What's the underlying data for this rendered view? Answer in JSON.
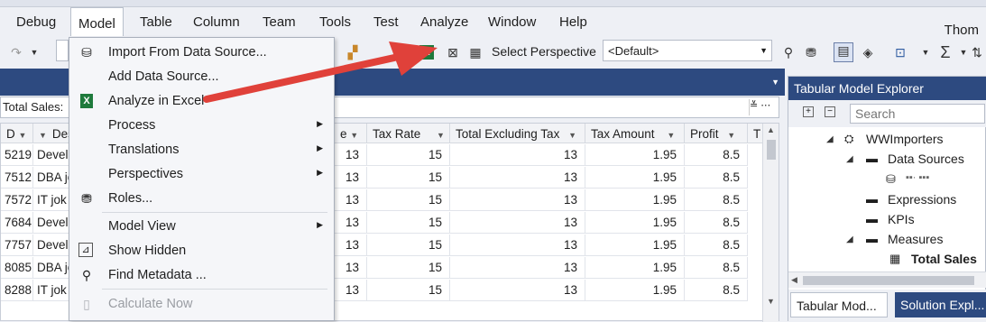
{
  "menubar": {
    "items": [
      "Debug",
      "Model",
      "Table",
      "Column",
      "Team",
      "Tools",
      "Test",
      "Analyze",
      "Window",
      "Help"
    ],
    "user": "Thom"
  },
  "toolbar": {
    "perspective_label": "Select Perspective",
    "perspective_value": "<Default>"
  },
  "model_menu": {
    "items": [
      {
        "label": "Import From Data Source...",
        "icon": "database-icon"
      },
      {
        "label": "Add Data Source...",
        "icon": ""
      },
      {
        "label": "Analyze in Excel",
        "icon": "excel-icon"
      },
      {
        "label": "Process",
        "submenu": true
      },
      {
        "label": "Translations",
        "submenu": true
      },
      {
        "label": "Perspectives",
        "submenu": true
      },
      {
        "label": "Roles...",
        "icon": "roles-icon"
      },
      {
        "label": "Model View",
        "submenu": true
      },
      {
        "label": "Show Hidden",
        "icon": "show-hidden-icon"
      },
      {
        "label": "Find Metadata ...",
        "icon": "search-icon"
      },
      {
        "label": "Calculate Now",
        "icon": "calculate-icon",
        "disabled": true
      }
    ]
  },
  "formula": {
    "name": "Total Sales:"
  },
  "grid": {
    "headers": [
      "Tax Rate",
      "Total Excluding Tax",
      "Tax Amount",
      "Profit",
      "T"
    ],
    "partial_headers": [
      "D",
      "Descr",
      "e"
    ],
    "rows": [
      {
        "id": "5219",
        "desc": "Devel",
        "qty": "13",
        "tax_rate": "15",
        "total_ex": "13",
        "tax_amount": "1.95",
        "profit": "8.5"
      },
      {
        "id": "7512",
        "desc": "DBA jo",
        "qty": "13",
        "tax_rate": "15",
        "total_ex": "13",
        "tax_amount": "1.95",
        "profit": "8.5"
      },
      {
        "id": "7572",
        "desc": "IT jok",
        "qty": "13",
        "tax_rate": "15",
        "total_ex": "13",
        "tax_amount": "1.95",
        "profit": "8.5"
      },
      {
        "id": "7684",
        "desc": "Devel",
        "qty": "13",
        "tax_rate": "15",
        "total_ex": "13",
        "tax_amount": "1.95",
        "profit": "8.5"
      },
      {
        "id": "7757",
        "desc": "Devel",
        "qty": "13",
        "tax_rate": "15",
        "total_ex": "13",
        "tax_amount": "1.95",
        "profit": "8.5"
      },
      {
        "id": "8085",
        "desc": "DBA jo",
        "qty": "13",
        "tax_rate": "15",
        "total_ex": "13",
        "tax_amount": "1.95",
        "profit": "8.5"
      },
      {
        "id": "8288",
        "desc": "IT jok",
        "qty": "13",
        "tax_rate": "15",
        "total_ex": "13",
        "tax_amount": "1.95",
        "profit": "8.5"
      }
    ]
  },
  "explorer": {
    "title": "Tabular Model Explorer",
    "search_placeholder": "Search",
    "tree": {
      "root": "WWImporters",
      "data_sources": "Data Sources",
      "data_source_item": "▪▪· ▪▪▪",
      "expressions": "Expressions",
      "kpis": "KPIs",
      "measures": "Measures",
      "measure_item": "Total Sales"
    },
    "tabs": [
      "Tabular Mod...",
      "Solution Expl..."
    ]
  }
}
